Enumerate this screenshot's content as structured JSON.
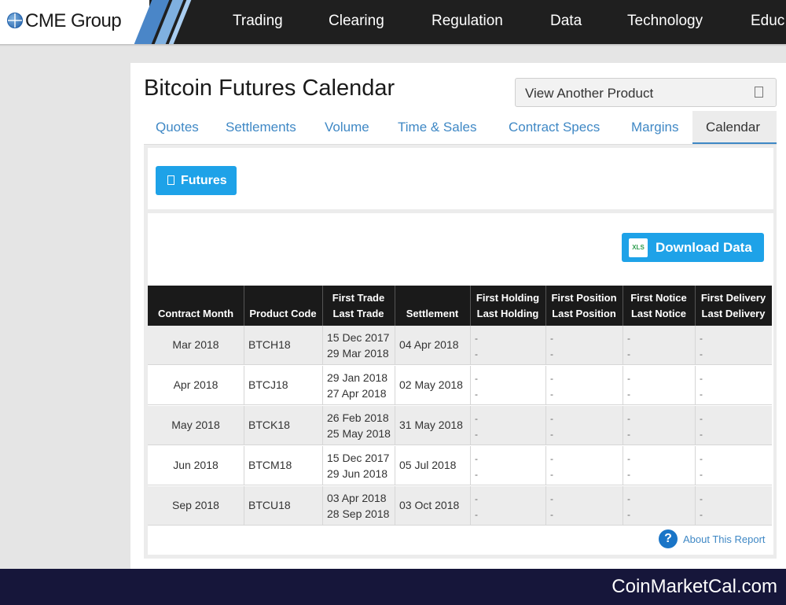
{
  "header": {
    "logo_text": "CME Group",
    "nav": [
      "Trading",
      "Clearing",
      "Regulation",
      "Data",
      "Technology",
      "Educ"
    ]
  },
  "page": {
    "title": "Bitcoin Futures Calendar",
    "view_another_product": "View Another Product"
  },
  "tabs": [
    {
      "label": "Quotes"
    },
    {
      "label": "Settlements"
    },
    {
      "label": "Volume"
    },
    {
      "label": "Time & Sales"
    },
    {
      "label": "Contract Specs"
    },
    {
      "label": "Margins"
    },
    {
      "label": "Calendar",
      "active": true
    }
  ],
  "filter": {
    "futures_label": "Futures"
  },
  "download": {
    "label": "Download Data",
    "icon_text": "XLS"
  },
  "table": {
    "headers": [
      [
        "Contract Month"
      ],
      [
        "Product Code"
      ],
      [
        "First Trade",
        "Last Trade"
      ],
      [
        "Settlement"
      ],
      [
        "First Holding",
        "Last Holding"
      ],
      [
        "First Position",
        "Last Position"
      ],
      [
        "First Notice",
        "Last Notice"
      ],
      [
        "First Delivery",
        "Last Delivery"
      ]
    ],
    "rows": [
      {
        "month": "Mar 2018",
        "code": "BTCH18",
        "first_trade": "15 Dec 2017",
        "last_trade": "29 Mar 2018",
        "settlement": "04 Apr 2018"
      },
      {
        "month": "Apr 2018",
        "code": "BTCJ18",
        "first_trade": "29 Jan 2018",
        "last_trade": "27 Apr 2018",
        "settlement": "02 May 2018"
      },
      {
        "month": "May 2018",
        "code": "BTCK18",
        "first_trade": "26 Feb 2018",
        "last_trade": "25 May 2018",
        "settlement": "31 May 2018"
      },
      {
        "month": "Jun 2018",
        "code": "BTCM18",
        "first_trade": "15 Dec 2017",
        "last_trade": "29 Jun 2018",
        "settlement": "05 Jul 2018"
      },
      {
        "month": "Sep 2018",
        "code": "BTCU18",
        "first_trade": "03 Apr 2018",
        "last_trade": "28 Sep 2018",
        "settlement": "03 Oct 2018"
      }
    ],
    "empty_value": "-"
  },
  "about": {
    "label": "About This Report",
    "icon_text": "?"
  },
  "footer": {
    "watermark": "CoinMarketCal.com"
  }
}
